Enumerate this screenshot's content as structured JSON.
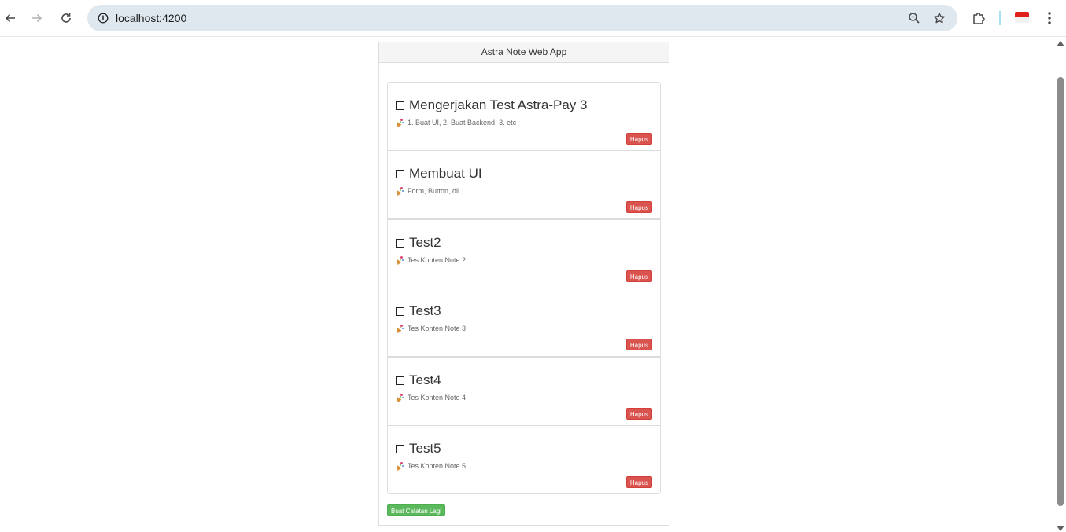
{
  "browser": {
    "url": "localhost:4200",
    "icons": {
      "back": "back-arrow-icon",
      "forward": "forward-arrow-icon",
      "reload": "reload-icon",
      "info": "site-info-icon",
      "zoom": "zoom-icon",
      "bookmark": "star-icon",
      "extensions": "puzzle-icon",
      "profile": "indonesia-flag-icon",
      "menu": "kebab-menu-icon"
    }
  },
  "app": {
    "title": "Astra Note Web App",
    "notes": [
      {
        "title": "Mengerjakan Test Astra-Pay 3",
        "content": "1. Buat UI, 2. Buat Backend, 3. etc",
        "delete_label": "Hapus"
      },
      {
        "title": "Membuat UI",
        "content": "Form, Button, dll",
        "delete_label": "Hapus"
      },
      {
        "title": "Test2",
        "content": "Tes Konten Note 2",
        "delete_label": "Hapus"
      },
      {
        "title": "Test3",
        "content": "Tes Konten Note 3",
        "delete_label": "Hapus"
      },
      {
        "title": "Test4",
        "content": "Tes Konten Note 4",
        "delete_label": "Hapus"
      },
      {
        "title": "Test5",
        "content": "Tes Konten Note 5",
        "delete_label": "Hapus"
      }
    ],
    "add_label": "Buat Catatan Lagi"
  },
  "colors": {
    "delete": "#d9534f",
    "add": "#5cb85c",
    "omnibox": "#dfe8ee"
  }
}
